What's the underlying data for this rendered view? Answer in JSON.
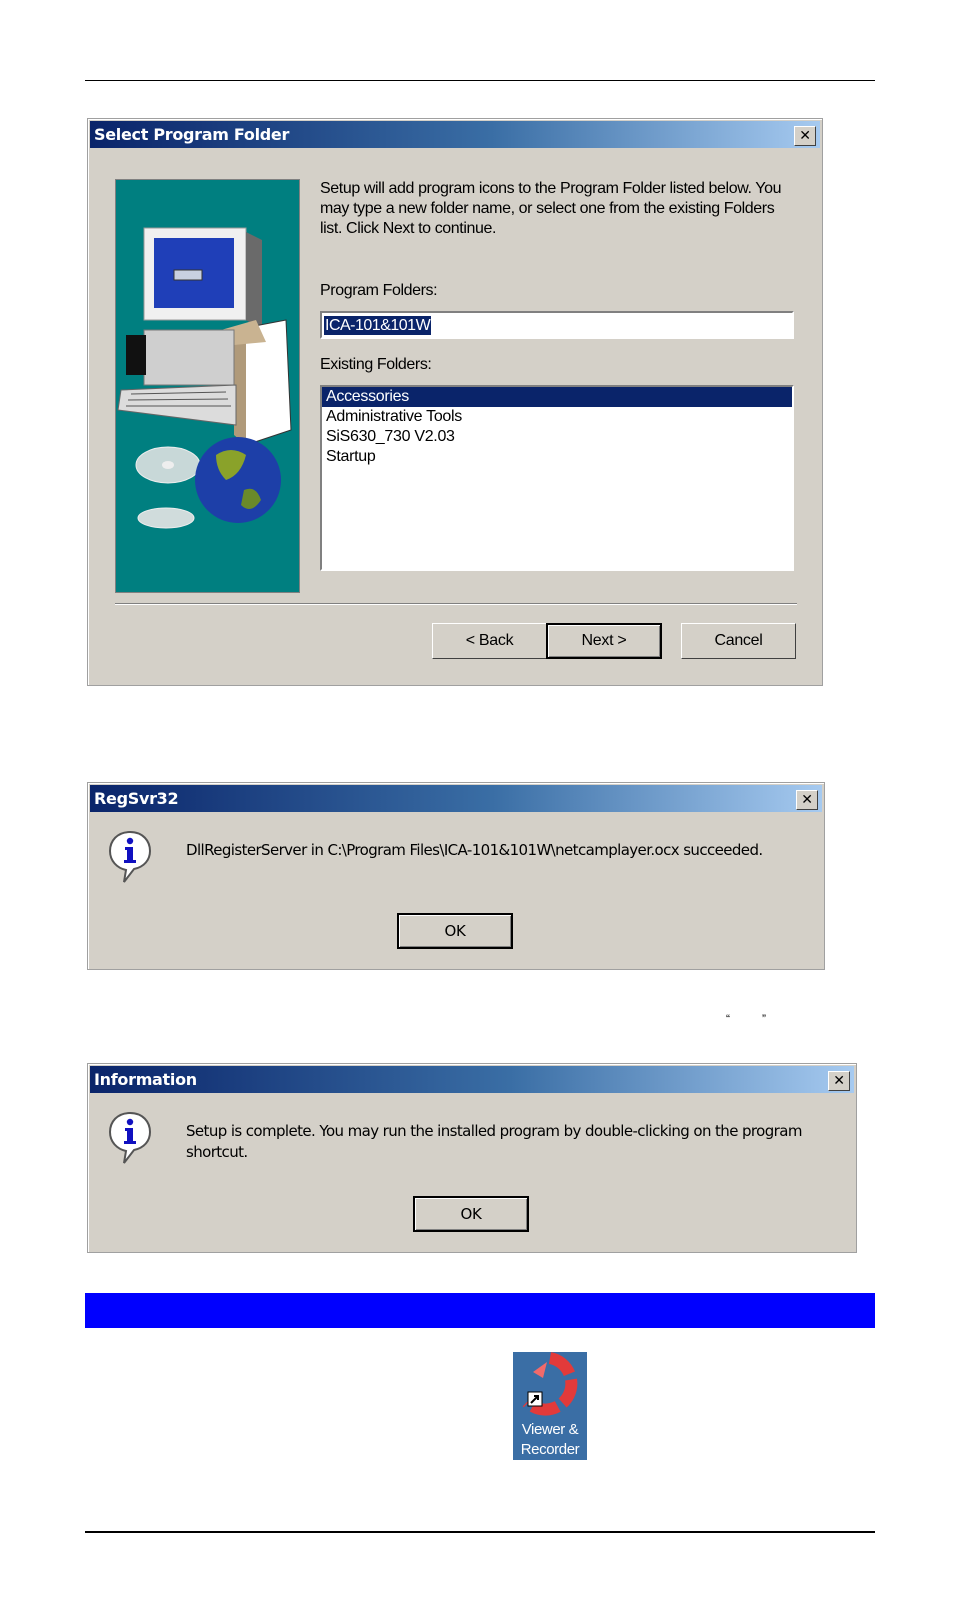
{
  "page": {
    "colors": {
      "title_start": "#0a246a",
      "title_end": "#a6caf0",
      "dialog_bg": "#d4d0c8",
      "section_bar": "#0000ff",
      "selection": "#0a246a",
      "side_panel": "#007f80"
    }
  },
  "select_program_folder": {
    "title": "Select Program Folder",
    "close_glyph": "✕",
    "intro": "Setup will add program icons to the Program Folder listed below. You may type a new folder name, or select one from the existing Folders list.  Click Next to continue.",
    "program_folders_label": "Program Folders:",
    "program_folder_value": "ICA-101&101W",
    "existing_folders_label": "Existing Folders:",
    "existing_folders": [
      {
        "label": "Accessories",
        "selected": true
      },
      {
        "label": "Administrative Tools",
        "selected": false
      },
      {
        "label": "SiS630_730 V2.03",
        "selected": false
      },
      {
        "label": "Startup",
        "selected": false
      }
    ],
    "buttons": {
      "back": "< Back",
      "next": "Next >",
      "cancel": "Cancel"
    }
  },
  "regsvr32": {
    "title": "RegSvr32",
    "close_glyph": "✕",
    "icon": "information-icon",
    "message": "DllRegisterServer in C:\\Program Files\\ICA-101&101W\\netcamplayer.ocx succeeded.",
    "ok": "OK"
  },
  "quote_marks": {
    "open": "“",
    "close": "”"
  },
  "information": {
    "title": "Information",
    "close_glyph": "✕",
    "icon": "information-icon",
    "message": "Setup is complete.  You may run the installed program by double-clicking on the program shortcut.",
    "ok": "OK"
  },
  "desktop_shortcut": {
    "icon": "viewer-recorder-icon",
    "label_line1": "Viewer &",
    "label_line2": "Recorder"
  }
}
